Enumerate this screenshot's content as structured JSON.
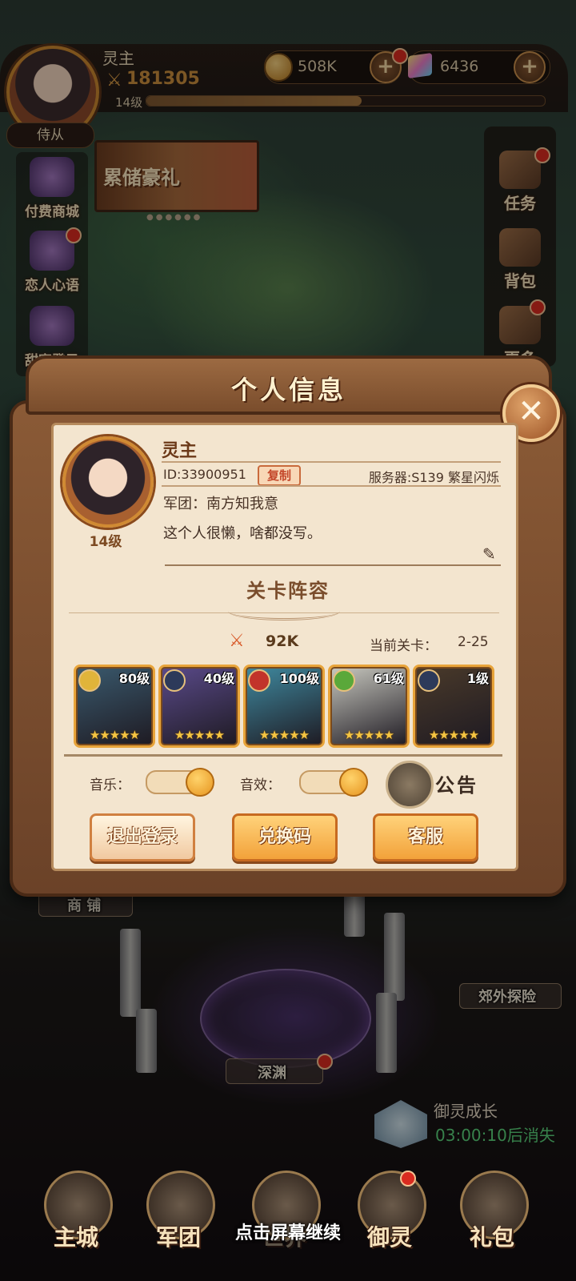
{
  "top": {
    "name": "灵主",
    "power": "181305",
    "level": "14级",
    "exp_fraction": 0.54,
    "gold": "508K",
    "gems": "6436",
    "follower_tab": "侍从"
  },
  "left_menu": [
    "付费商城",
    "恋人心语",
    "甜蜜登录"
  ],
  "banner": {
    "text": "累储豪礼",
    "dots": "●●●●●●"
  },
  "right_menu": [
    "任务",
    "背包",
    "更多"
  ],
  "modal": {
    "title": "个人信息",
    "close_glyph": "✕",
    "level": "14级",
    "name": "灵主",
    "id": "ID:33900951",
    "copy": "复制",
    "server": "服务器:S139 繁星闪烁",
    "guild": "军团：南方知我意",
    "signature": "这个人很懒，啥都没写。",
    "lineup_title": "关卡阵容",
    "lineup_power": "92K",
    "stage_label": "当前关卡：",
    "stage_value": "2-25",
    "heroes": [
      {
        "level": "80级",
        "stars": "★★★★★",
        "element": "gold",
        "color": "#3a5a6e"
      },
      {
        "level": "40级",
        "stars": "★★★★★",
        "element": "dark",
        "color": "#5a4a8a"
      },
      {
        "level": "100级",
        "stars": "★★★★★",
        "element": "fire",
        "color": "#3f8aa0"
      },
      {
        "level": "61级",
        "stars": "★★★★★",
        "element": "wind",
        "color": "#c9c9c0"
      },
      {
        "level": "1级",
        "stars": "★★★★★",
        "element": "dark",
        "color": "#4a3a2a"
      }
    ],
    "music_label": "音乐：",
    "sfx_label": "音效：",
    "notice": "公告",
    "logout": "退出登录",
    "redeem": "兑换码",
    "service": "客服"
  },
  "bg": {
    "shop": "商 铺",
    "explore": "郊外探险",
    "abyss": "深渊",
    "growth_title": "御灵成长",
    "growth_timer": "03:00:10后消失"
  },
  "nav": [
    "主城",
    "军团",
    "世界",
    "御灵",
    "礼包"
  ],
  "continue_hint": "点击屏幕继续",
  "colors": {
    "accent": "#e8a43a",
    "panel": "#f3e5cf",
    "frame": "#7a4d2c"
  }
}
